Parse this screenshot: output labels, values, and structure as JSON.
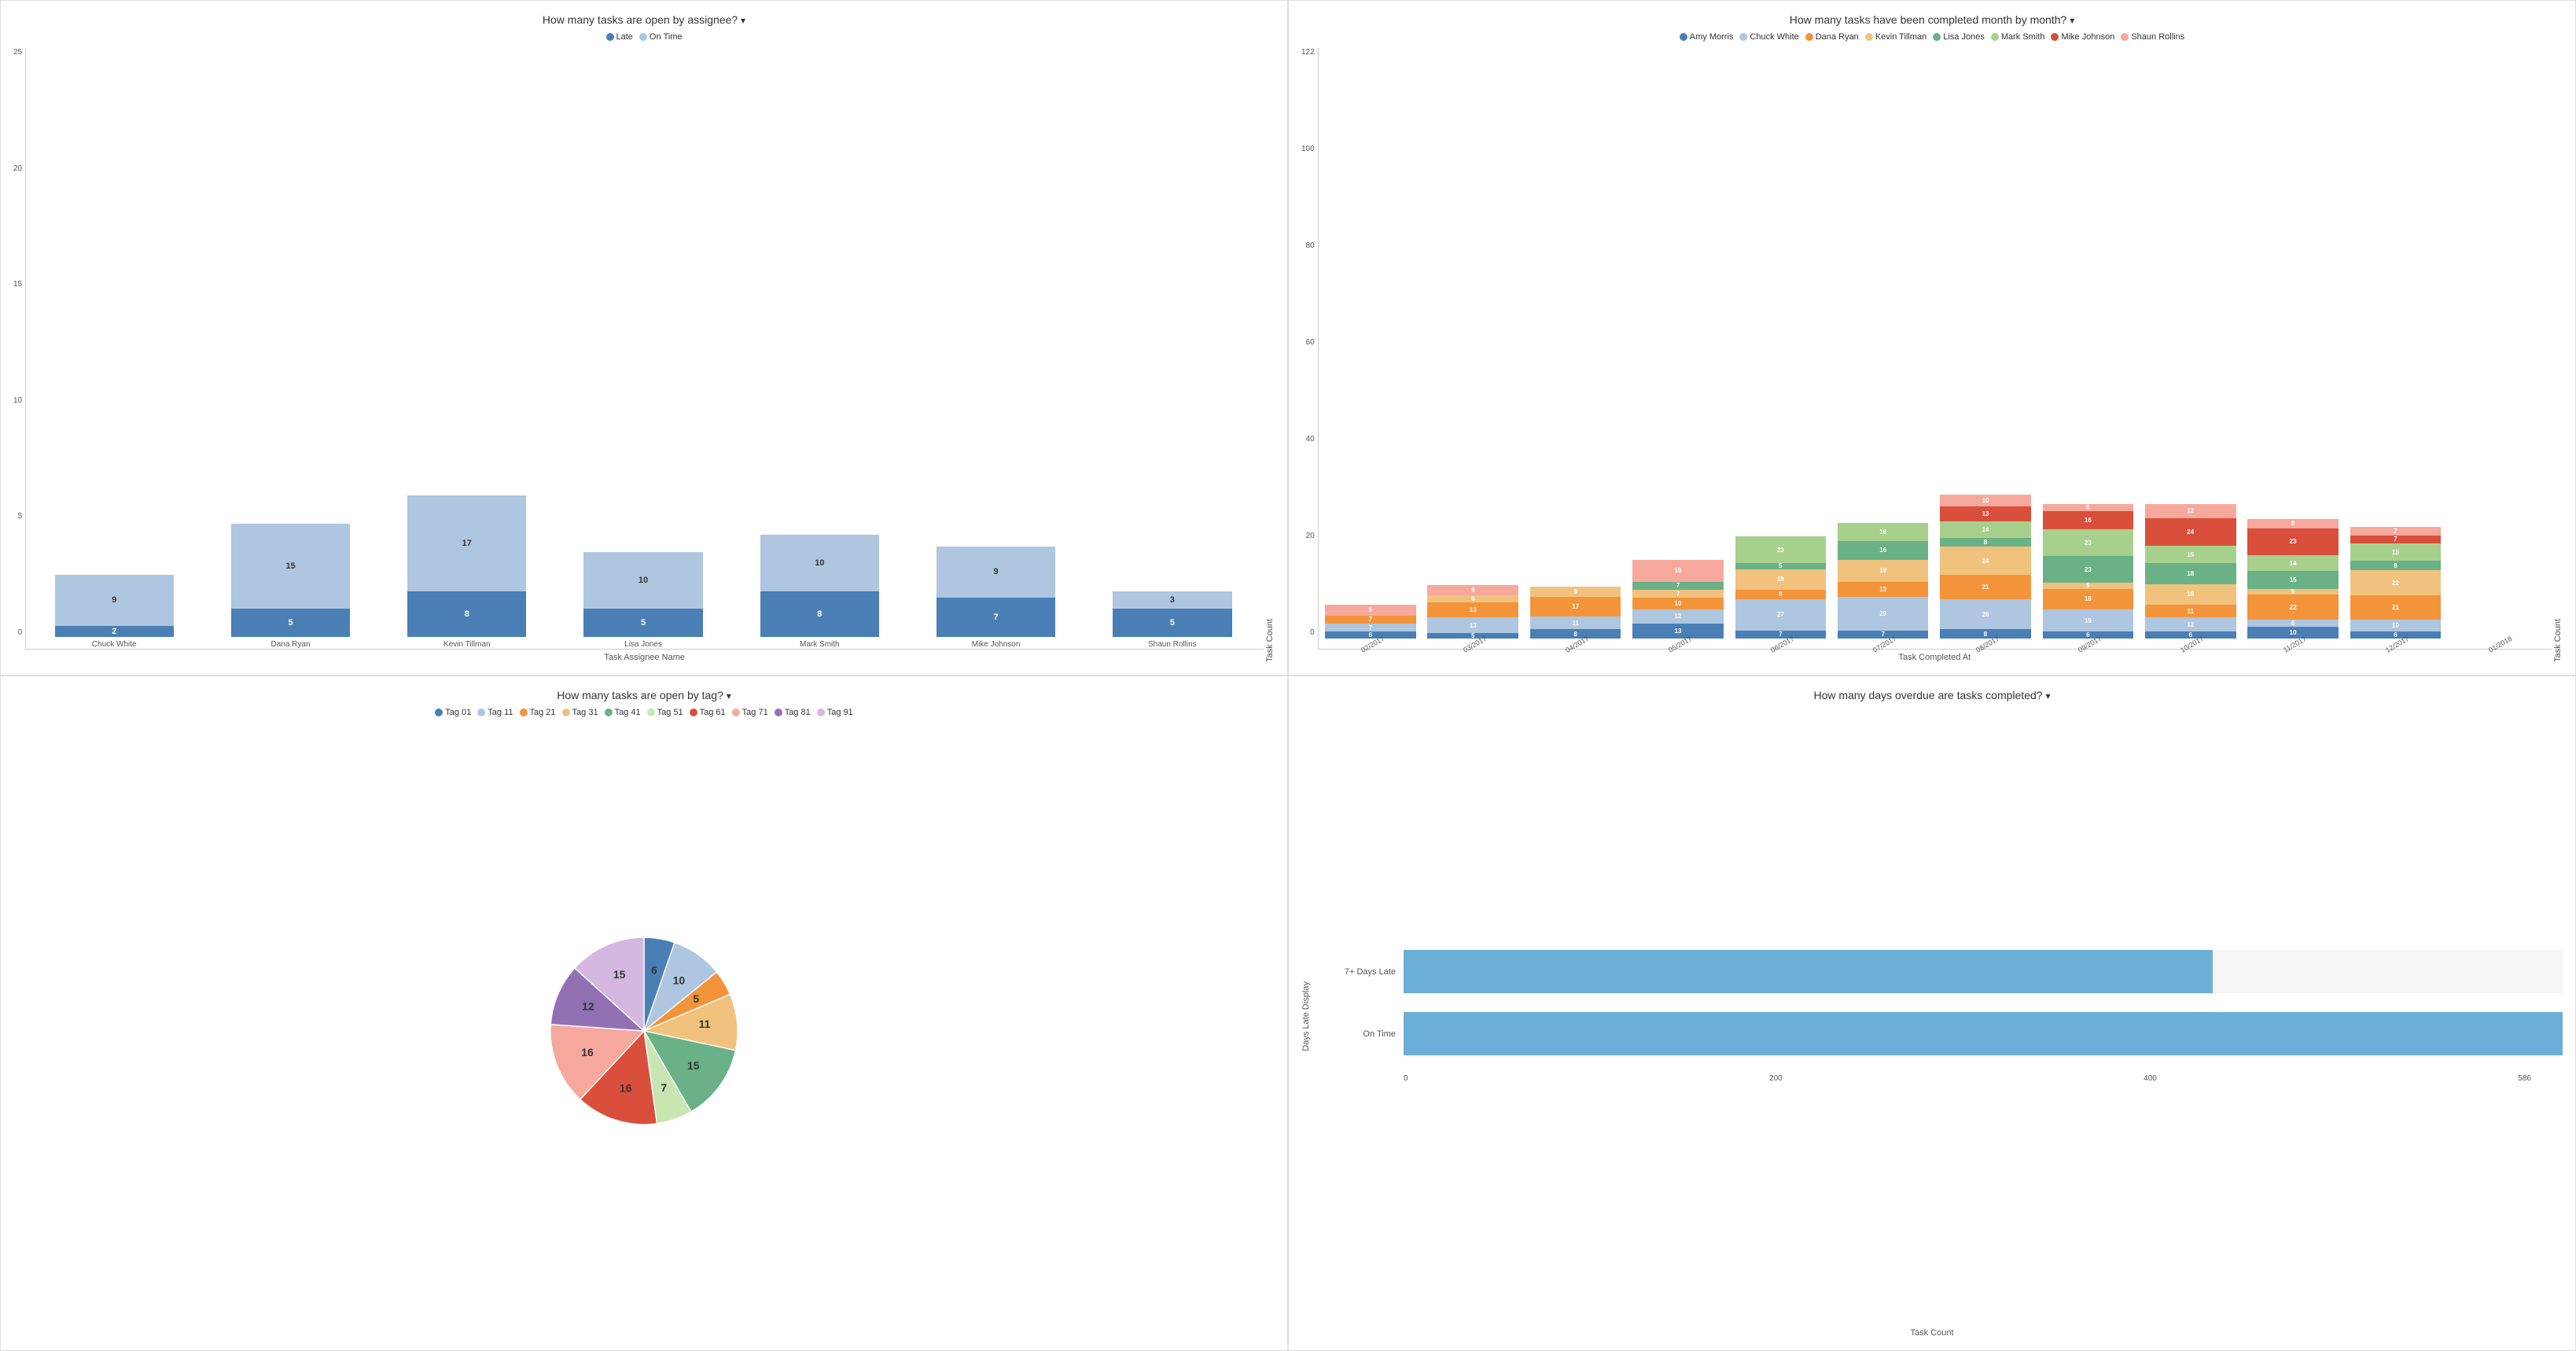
{
  "charts": {
    "assignee": {
      "title": "How many tasks are open by assignee?",
      "xAxisLabel": "Task Assignee Name",
      "yAxisLabel": "Task Count",
      "legend": [
        {
          "label": "Late",
          "color": "#4a7fb5"
        },
        {
          "label": "On Time",
          "color": "#aec6df"
        }
      ],
      "bars": [
        {
          "name": "Chuck White",
          "late": 2,
          "onTime": 9
        },
        {
          "name": "Dana Ryan",
          "late": 5,
          "onTime": 15
        },
        {
          "name": "Kevin Tillman",
          "late": 8,
          "onTime": 17
        },
        {
          "name": "Lisa Jones",
          "late": 5,
          "onTime": 10
        },
        {
          "name": "Mark Smith",
          "late": 8,
          "onTime": 10
        },
        {
          "name": "Mike Johnson",
          "late": 7,
          "onTime": 9
        },
        {
          "name": "Shaun Rollins",
          "late": 5,
          "onTime": 3
        }
      ],
      "yTicks": [
        0,
        5,
        10,
        15,
        20,
        25
      ]
    },
    "monthly": {
      "title": "How many tasks have been completed month by month?",
      "xAxisLabel": "Task Completed At",
      "yAxisLabel": "Task Count",
      "legend": [
        {
          "label": "Amy Morris",
          "color": "#4a7fb5"
        },
        {
          "label": "Chuck White",
          "color": "#aec6df"
        },
        {
          "label": "Dana Ryan",
          "color": "#f4943a"
        },
        {
          "label": "Kevin Tillman",
          "color": "#f0c27e"
        },
        {
          "label": "Lisa Jones",
          "color": "#6ab187"
        },
        {
          "label": "Mark Smith",
          "color": "#a8d08d"
        },
        {
          "label": "Mike Johnson",
          "color": "#d94f3c"
        },
        {
          "label": "Shaun Rollins",
          "color": "#f7a89c"
        }
      ],
      "months": [
        {
          "label": "02/2017",
          "amy": 6,
          "chuck": 7,
          "dana": 7,
          "kevin": 0,
          "lisa": 0,
          "mark": 0,
          "mike": 0,
          "shaun": 9
        },
        {
          "label": "03/2017",
          "amy": 5,
          "chuck": 13,
          "dana": 13,
          "kevin": 6,
          "lisa": 0,
          "mark": 0,
          "mike": 0,
          "shaun": 9
        },
        {
          "label": "04/2017",
          "amy": 8,
          "chuck": 11,
          "dana": 17,
          "kevin": 9,
          "lisa": 0,
          "mark": 0,
          "mike": 0,
          "shaun": 0
        },
        {
          "label": "05/2017",
          "amy": 13,
          "chuck": 12,
          "dana": 10,
          "kevin": 7,
          "lisa": 7,
          "mark": 0,
          "mike": 0,
          "shaun": 19
        },
        {
          "label": "06/2017",
          "amy": 7,
          "chuck": 27,
          "dana": 8,
          "kevin": 18,
          "lisa": 5,
          "mark": 23,
          "mike": 0,
          "shaun": 0
        },
        {
          "label": "07/2017",
          "amy": 7,
          "chuck": 29,
          "dana": 13,
          "kevin": 19,
          "lisa": 16,
          "mark": 16,
          "mike": 0,
          "shaun": 0
        },
        {
          "label": "08/2017",
          "amy": 8,
          "chuck": 26,
          "dana": 21,
          "kevin": 24,
          "lisa": 8,
          "mark": 14,
          "mike": 13,
          "shaun": 10
        },
        {
          "label": "09/2017",
          "amy": 6,
          "chuck": 19,
          "dana": 18,
          "kevin": 5,
          "lisa": 23,
          "mark": 23,
          "mike": 16,
          "shaun": 6
        },
        {
          "label": "10/2017",
          "amy": 6,
          "chuck": 12,
          "dana": 11,
          "kevin": 18,
          "lisa": 18,
          "mark": 15,
          "mike": 24,
          "shaun": 12
        },
        {
          "label": "11/2017",
          "amy": 10,
          "chuck": 6,
          "dana": 22,
          "kevin": 5,
          "lisa": 15,
          "mark": 14,
          "mike": 23,
          "shaun": 8
        },
        {
          "label": "12/2017",
          "amy": 6,
          "chuck": 10,
          "dana": 21,
          "kevin": 22,
          "lisa": 8,
          "mark": 15,
          "mike": 7,
          "shaun": 7
        },
        {
          "label": "01/2018",
          "amy": 0,
          "chuck": 0,
          "dana": 0,
          "kevin": 0,
          "lisa": 0,
          "mark": 0,
          "mike": 0,
          "shaun": 0
        }
      ]
    },
    "tags": {
      "title": "How many tasks are open by tag?",
      "legend": [
        {
          "label": "Tag 01",
          "color": "#4a7fb5"
        },
        {
          "label": "Tag 11",
          "color": "#aec6df"
        },
        {
          "label": "Tag 21",
          "color": "#f4943a"
        },
        {
          "label": "Tag 31",
          "color": "#f0c27e"
        },
        {
          "label": "Tag 41",
          "color": "#6ab187"
        },
        {
          "label": "Tag 51",
          "color": "#c8e6b2"
        },
        {
          "label": "Tag 61",
          "color": "#d94f3c"
        },
        {
          "label": "Tag 71",
          "color": "#f7a89c"
        },
        {
          "label": "Tag 81",
          "color": "#9370b4"
        },
        {
          "label": "Tag 91",
          "color": "#d4b8e0"
        }
      ],
      "slices": [
        {
          "label": "6",
          "value": 6,
          "color": "#4a7fb5"
        },
        {
          "label": "10",
          "value": 10,
          "color": "#aec6df"
        },
        {
          "label": "5",
          "value": 5,
          "color": "#f4943a"
        },
        {
          "label": "11",
          "value": 11,
          "color": "#f0c27e"
        },
        {
          "label": "15",
          "value": 15,
          "color": "#6ab187"
        },
        {
          "label": "7",
          "value": 7,
          "color": "#c8e6b2"
        },
        {
          "label": "16",
          "value": 16,
          "color": "#d94f3c"
        },
        {
          "label": "16",
          "value": 16,
          "color": "#f7a89c"
        },
        {
          "label": "12",
          "value": 12,
          "color": "#9370b4"
        },
        {
          "label": "15",
          "value": 15,
          "color": "#d4b8e0"
        }
      ]
    },
    "overdue": {
      "title": "How many days overdue are tasks completed?",
      "xAxisLabel": "Task Count",
      "yAxisLabel": "Days Late Display",
      "bars": [
        {
          "label": "7+ Days Late",
          "value": 409,
          "max": 586
        },
        {
          "label": "On Time",
          "value": 586,
          "max": 586
        }
      ],
      "xTicks": [
        0,
        200,
        400,
        586
      ]
    }
  }
}
